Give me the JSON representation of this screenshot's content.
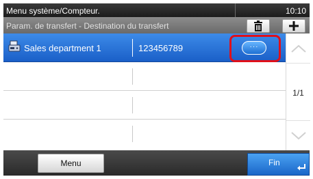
{
  "header": {
    "title": "Menu système/Compteur.",
    "time": "10:10"
  },
  "subheader": {
    "title": "Param. de transfert - Destination du transfert",
    "delete_icon": "trash-icon",
    "add_icon": "plus-icon"
  },
  "list": {
    "rows": [
      {
        "name": "Sales department 1",
        "number": "123456789",
        "icon": "fax-icon",
        "selected": true
      },
      {
        "name": "",
        "number": "",
        "selected": false
      },
      {
        "name": "",
        "number": "",
        "selected": false
      },
      {
        "name": "",
        "number": "",
        "selected": false
      }
    ],
    "detail_button_label": "···",
    "page_indicator": "1/1"
  },
  "footer": {
    "menu_label": "Menu",
    "fin_label": "Fin"
  },
  "colors": {
    "selected_row": "#2a74da",
    "highlight_frame": "#e0101a",
    "header_bg": "#2a2a2a"
  }
}
